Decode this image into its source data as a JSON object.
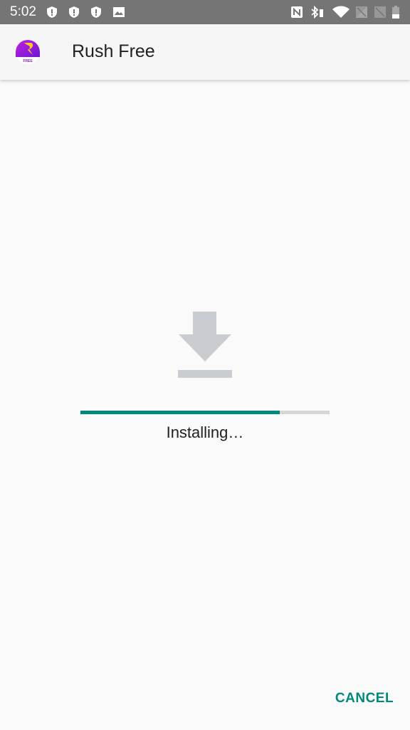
{
  "status_bar": {
    "time": "5:02",
    "left_icons": [
      "shield-alert-icon",
      "shield-alert-icon",
      "shield-alert-icon",
      "image-icon"
    ],
    "right_icons": [
      "nfc-icon",
      "bluetooth-battery-icon",
      "wifi-icon",
      "no-signal-icon",
      "no-signal-icon",
      "battery-low-icon"
    ]
  },
  "app_bar": {
    "title": "Rush Free",
    "logo_label": "FREE"
  },
  "installer": {
    "icon": "download-icon",
    "progress_percent": 80,
    "status_text": "Installing…",
    "accent_color": "#00897b"
  },
  "actions": {
    "cancel_label": "CANCEL"
  }
}
